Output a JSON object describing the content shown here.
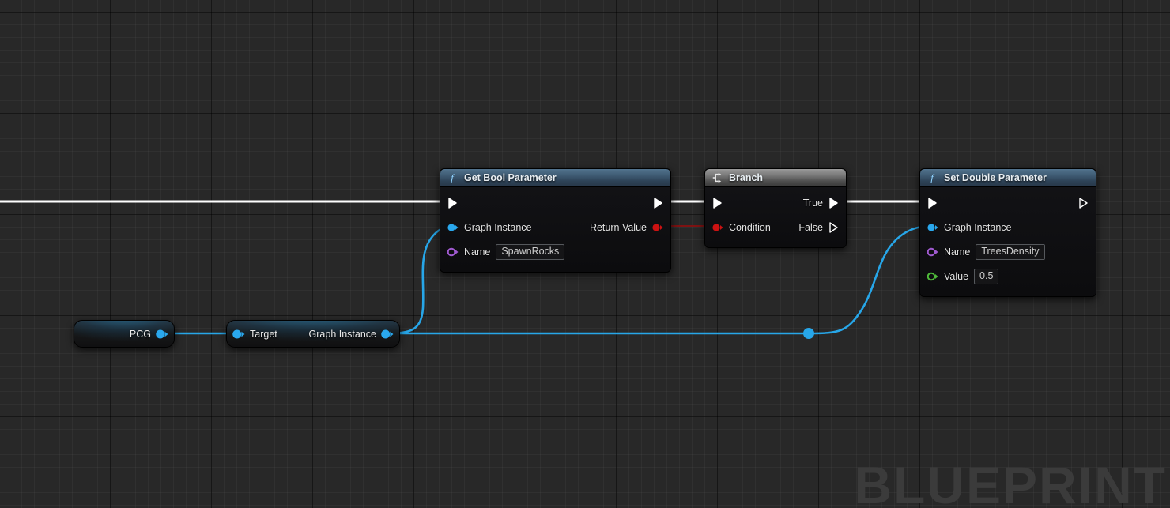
{
  "graph": {
    "watermark": "BLUEPRINT",
    "colors": {
      "exec_wire": "#ffffff",
      "bool_wire": "#8c1515",
      "object_wire": "#27a6e8",
      "pin_object": "#2aa8ee",
      "pin_name": "#a05ad0",
      "pin_double": "#4fba3a",
      "pin_bool": "#c81414",
      "header_function": "#3e5a72",
      "header_flow": "#777777",
      "node_body": "#0e0e10",
      "watermark_color": "#3b3b3b",
      "background": "#282828"
    }
  },
  "nodes": {
    "get_bool_parameter": {
      "title": "Get Bool Parameter",
      "icon": "function-f-icon",
      "inputs": [
        {
          "label": "",
          "type": "exec"
        },
        {
          "label": "Graph Instance",
          "type": "object"
        },
        {
          "label": "Name",
          "type": "name",
          "value": "SpawnRocks"
        }
      ],
      "outputs": [
        {
          "label": "",
          "type": "exec"
        },
        {
          "label": "Return Value",
          "type": "bool"
        }
      ]
    },
    "branch": {
      "title": "Branch",
      "icon": "branch-icon",
      "inputs": [
        {
          "label": "",
          "type": "exec"
        },
        {
          "label": "Condition",
          "type": "bool"
        }
      ],
      "outputs": [
        {
          "label": "True",
          "type": "exec"
        },
        {
          "label": "False",
          "type": "exec"
        }
      ]
    },
    "set_double_parameter": {
      "title": "Set Double Parameter",
      "icon": "function-f-icon",
      "inputs": [
        {
          "label": "",
          "type": "exec"
        },
        {
          "label": "Graph Instance",
          "type": "object"
        },
        {
          "label": "Name",
          "type": "name",
          "value": "TreesDensity"
        },
        {
          "label": "Value",
          "type": "double",
          "value": "0.5"
        }
      ],
      "outputs": [
        {
          "label": "",
          "type": "exec"
        }
      ]
    },
    "pcg_variable": {
      "label": "PCG"
    },
    "get_graph_instance": {
      "input_label": "Target",
      "output_label": "Graph Instance"
    }
  }
}
